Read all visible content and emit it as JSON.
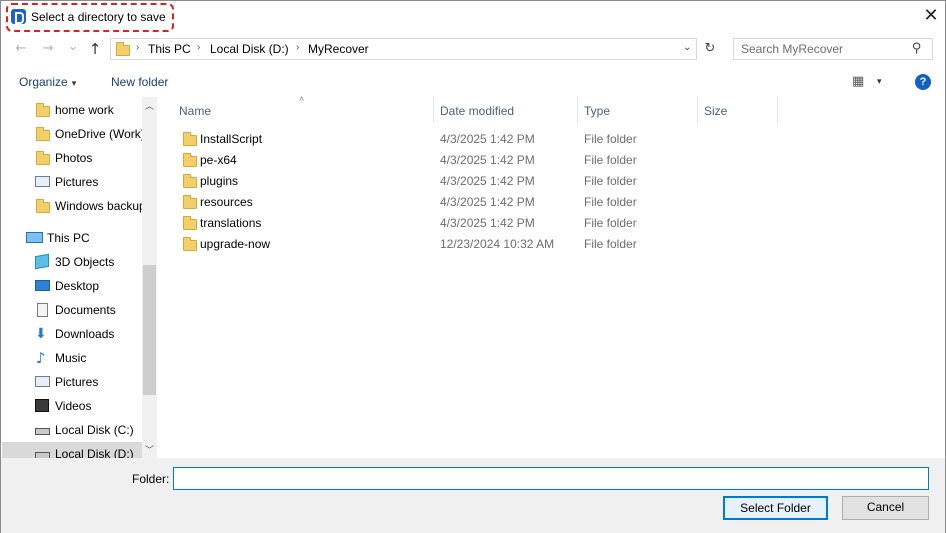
{
  "window": {
    "title": "Select a directory to save",
    "close_glyph": "✕",
    "accent_color": "#0078d7",
    "highlight_color": "#e0201e"
  },
  "address_bar": {
    "back_glyph": "←",
    "forward_glyph": "→",
    "recent_glyph": "⌄",
    "up_glyph": "↑",
    "breadcrumbs": [
      "This PC",
      "Local Disk (D:)",
      "MyRecover"
    ],
    "separator": "›",
    "dropdown_glyph": "⌄",
    "refresh_glyph": "↻"
  },
  "search": {
    "placeholder": "Search MyRecover",
    "icon": "search-icon",
    "glyph": "⚲"
  },
  "toolbar": {
    "organize_label": "Organize",
    "organize_caret": "▾",
    "new_folder_label": "New folder",
    "view_glyph": "▦",
    "view_caret": "▾",
    "help_glyph": "?"
  },
  "nav_pane": {
    "scroll_up_glyph": "︿",
    "scroll_down_glyph": "﹀",
    "items": [
      {
        "label": "home work",
        "icon": "folder-icon"
      },
      {
        "label": "OneDrive (Work)",
        "icon": "folder-icon"
      },
      {
        "label": "Photos",
        "icon": "folder-icon"
      },
      {
        "label": "Pictures",
        "icon": "pictures-icon"
      },
      {
        "label": "Windows backup",
        "icon": "folder-icon"
      },
      {
        "label": "This PC",
        "icon": "computer-icon"
      },
      {
        "label": "3D Objects",
        "icon": "3d-objects-icon"
      },
      {
        "label": "Desktop",
        "icon": "desktop-icon"
      },
      {
        "label": "Documents",
        "icon": "documents-icon"
      },
      {
        "label": "Downloads",
        "icon": "downloads-icon",
        "glyph": "⬇"
      },
      {
        "label": "Music",
        "icon": "music-icon",
        "glyph": "♪"
      },
      {
        "label": "Pictures",
        "icon": "pictures-icon"
      },
      {
        "label": "Videos",
        "icon": "videos-icon"
      },
      {
        "label": "Local Disk (C:)",
        "icon": "drive-icon"
      },
      {
        "label": "Local Disk (D:)",
        "icon": "drive-icon",
        "selected": true
      }
    ]
  },
  "file_list": {
    "sort_glyph": "˄",
    "columns": [
      "Name",
      "Date modified",
      "Type",
      "Size"
    ],
    "rows": [
      {
        "name": "InstallScript",
        "date": "4/3/2025 1:42 PM",
        "type": "File folder"
      },
      {
        "name": "pe-x64",
        "date": "4/3/2025 1:42 PM",
        "type": "File folder"
      },
      {
        "name": "plugins",
        "date": "4/3/2025 1:42 PM",
        "type": "File folder"
      },
      {
        "name": "resources",
        "date": "4/3/2025 1:42 PM",
        "type": "File folder"
      },
      {
        "name": "translations",
        "date": "4/3/2025 1:42 PM",
        "type": "File folder"
      },
      {
        "name": "upgrade-now",
        "date": "12/23/2024 10:32 AM",
        "type": "File folder"
      }
    ]
  },
  "footer": {
    "folder_label": "Folder:",
    "folder_value": "",
    "select_button": "Select Folder",
    "cancel_button": "Cancel"
  }
}
